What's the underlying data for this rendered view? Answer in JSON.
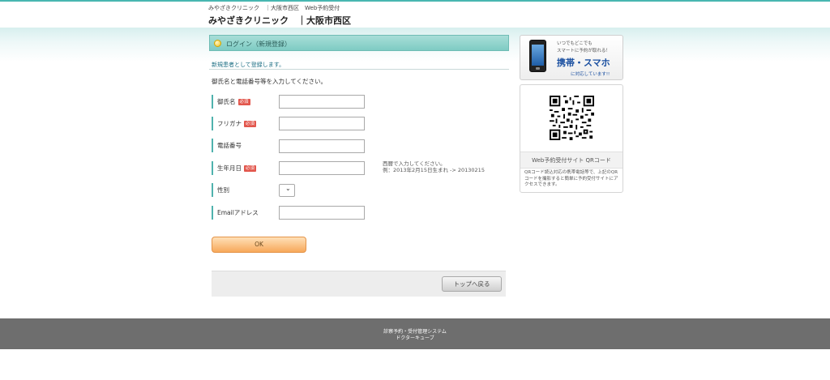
{
  "header": {
    "subtitle": "みやざきクリニック　｜大阪市西区　Web予約受付",
    "title": "みやざきクリニック　｜大阪市西区"
  },
  "login": {
    "title": "ログイン（新規登録）",
    "new_registration": "新規患者として登録します。",
    "intro": "御氏名と電話番号等を入力してください。"
  },
  "form": {
    "required_badge": "必須",
    "fields": [
      {
        "label": "御氏名",
        "required": true
      },
      {
        "label": "フリガナ",
        "required": true
      },
      {
        "label": "電話番号",
        "required": false
      },
      {
        "label": "生年月日",
        "required": true
      },
      {
        "label": "性別",
        "required": false
      },
      {
        "label": "Emailアドレス",
        "required": false
      }
    ],
    "birth_note_1": "西暦で入力してください。",
    "birth_note_2": "例：2013年2月15日生まれ -> 20130215",
    "ok_label": "OK",
    "back_label": "トップへ戻る"
  },
  "sidebar": {
    "ad_line1": "いつでもどこでも",
    "ad_line2": "スマートに予約が取れる！",
    "ad_big": "携帯・スマホ",
    "ad_line3": "に対応しています!!",
    "qr_title": "Web予約受付サイト QRコード",
    "qr_desc": "QRコード読込対応の携帯電話等で、上記のQRコードを撮影すると簡単に予約受付サイトにアクセスできます。"
  },
  "footer": {
    "line1": "診察予約・受付管理システム",
    "line2": "ドクターキューブ"
  },
  "colors": {
    "accent": "#48b7b1",
    "required": "#e2564c",
    "ok_button": "#f7a85a",
    "footer": "#6e6e6e"
  }
}
